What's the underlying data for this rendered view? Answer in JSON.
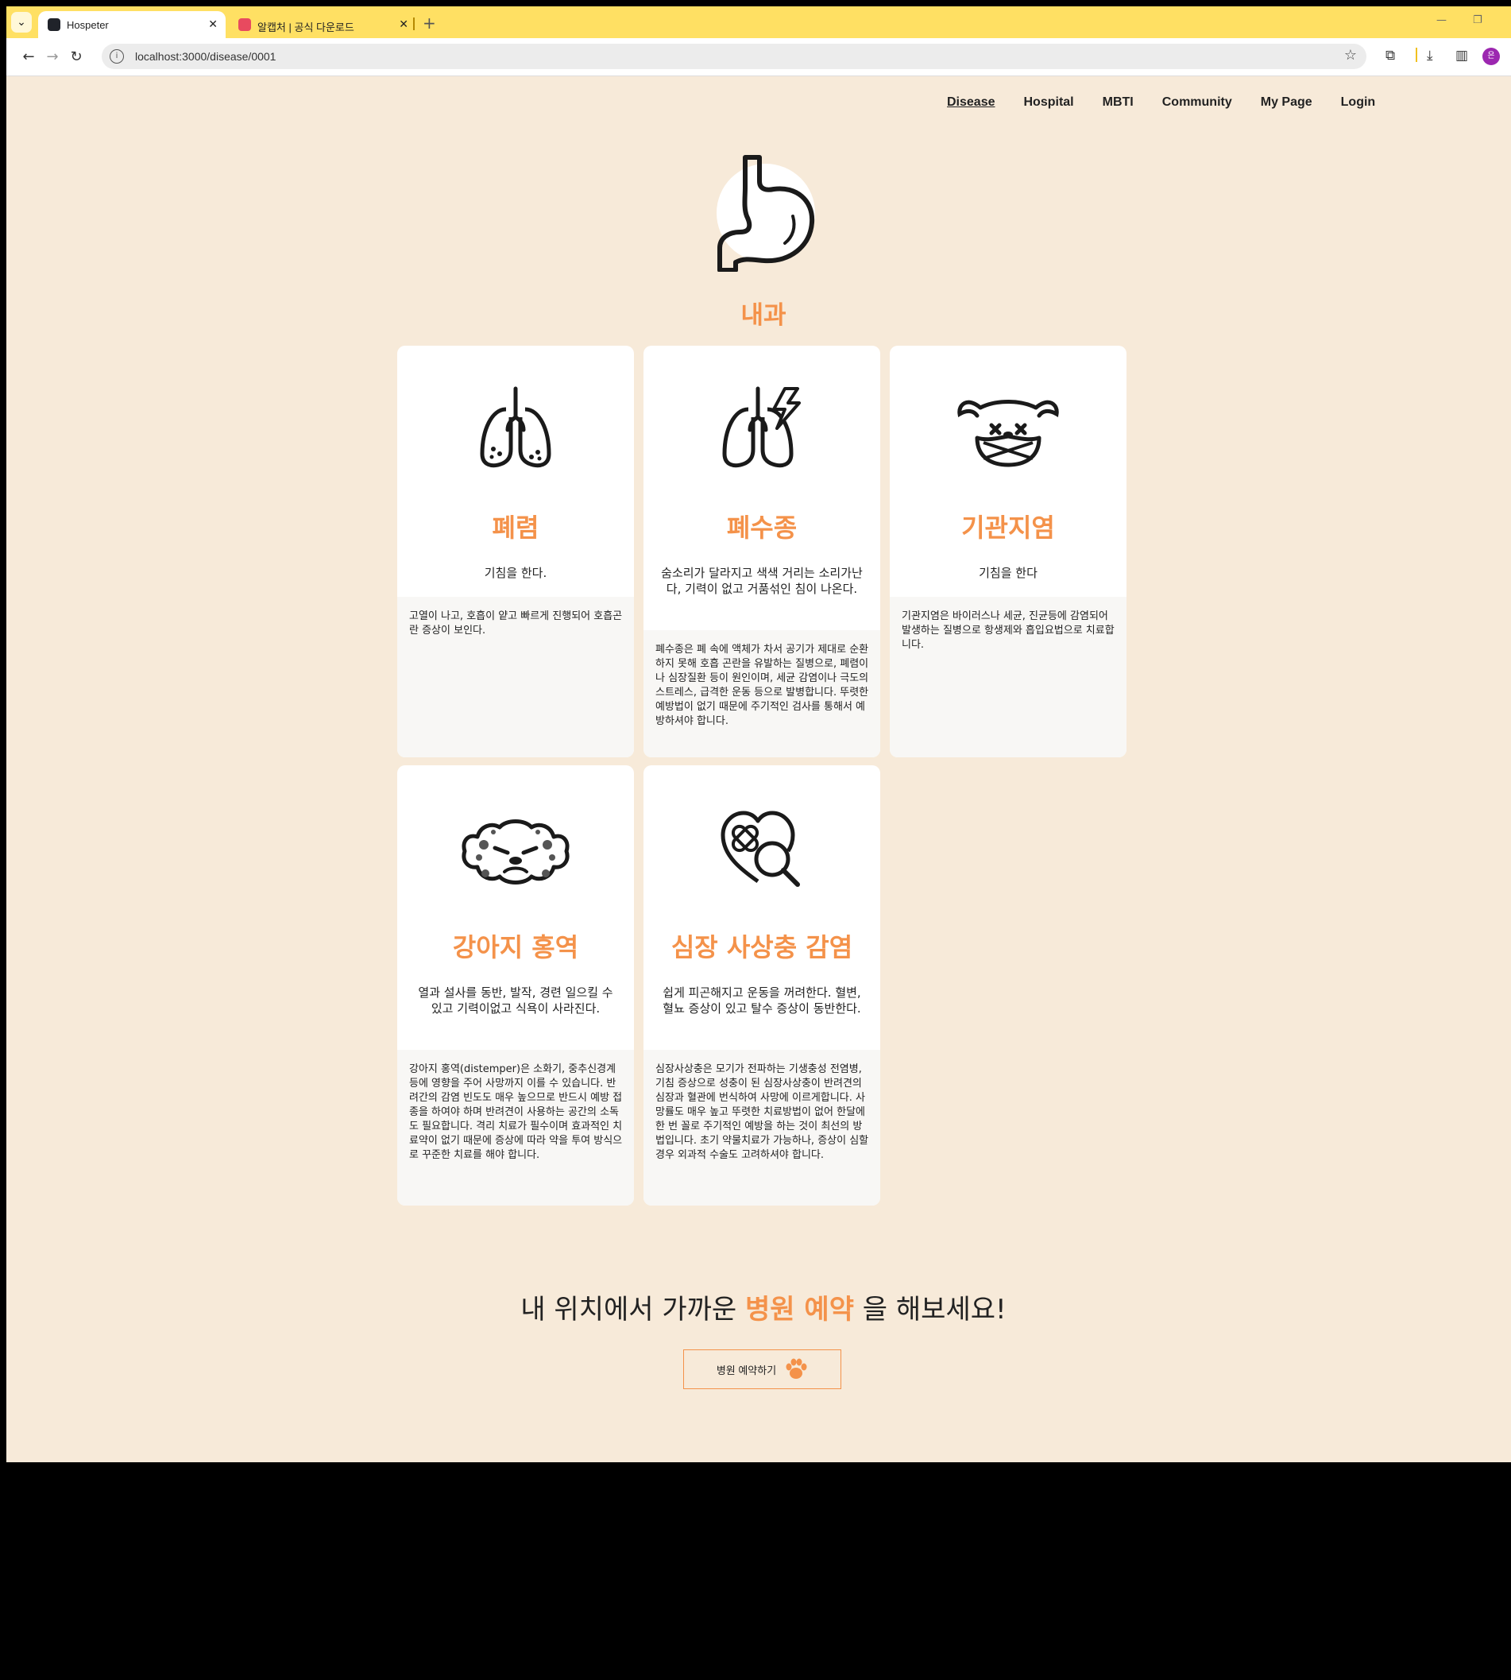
{
  "browser": {
    "tabs": [
      {
        "title": "Hospeter",
        "active": true
      },
      {
        "title": "알캡처 | 공식 다운로드",
        "active": false
      }
    ],
    "url": "localhost:3000/disease/0001",
    "profile_initial": "은"
  },
  "nav": {
    "items": [
      "Disease",
      "Hospital",
      "MBTI",
      "Community",
      "My Page",
      "Login"
    ],
    "current": "Disease"
  },
  "department": {
    "title": "내과",
    "icon": "stomach-icon"
  },
  "diseases": [
    {
      "name": "폐렴",
      "icon": "infected-lungs-icon",
      "summary": "기침을 한다.",
      "detail": "고열이 나고, 호흡이 얕고 빠르게 진행되어 호흡곤란 증상이 보인다."
    },
    {
      "name": "폐수종",
      "icon": "lungs-lightning-icon",
      "summary": "숨소리가 달라지고 색색 거리는 소리가난다, 기력이 없고 거품섞인 침이 나온다.",
      "detail": "폐수종은 폐 속에 액체가 차서 공기가 제대로 순환하지 못해 호흡 곤란을 유발하는 질병으로, 폐렴이나 심장질환 등이 원인이며, 세균 감염이나 극도의 스트레스, 급격한 운동 등으로 발병합니다. 뚜렷한 예방법이 없기 때문에 주기적인 검사를 통해서 예방하셔야 합니다."
    },
    {
      "name": "기관지염",
      "icon": "dog-mask-icon",
      "summary": "기침을 한다",
      "detail": "기관지염은 바이러스나 세균, 진균등에 감염되어 발생하는 질병으로 항생제와 흡입요법으로 치료합니다."
    },
    {
      "name": "강아지 홍역",
      "icon": "sick-dog-face-icon",
      "summary": "열과 설사를 동반, 발작, 경련 일으킬 수 있고 기력이없고 식욕이 사라진다.",
      "detail": "강아지 홍역(distemper)은 소화기, 중추신경계 등에 영향을 주어 사망까지 이를 수 있습니다. 반려간의 감염 빈도도 매우 높으므로 반드시 예방 접종을 하여야 하며 반려견이 사용하는 공간의 소독도 필요합니다. 격리 치료가 필수이며 효과적인 치료약이 없기 때문에 증상에 따라 약을 투여 방식으로 꾸준한 치료를 해야 합니다."
    },
    {
      "name": "심장 사상충 감염",
      "icon": "heart-magnifier-icon",
      "summary": "쉽게 피곤해지고 운동을 꺼려한다. 혈변, 혈뇨 증상이 있고 탈수 증상이 동반한다.",
      "detail": "심장사상충은 모기가 전파하는 기생충성 전염병, 기침 증상으로 성충이 된 심장사상충이 반려견의 심장과 혈관에 번식하여 사망에 이르게합니다. 사망률도 매우 높고 뚜렷한 치료방법이 없어 한달에 한 번 꼴로 주기적인 예방을 하는 것이 최선의 방법입니다. 초기 약물치료가 가능하나, 증상이 심할 경우 외과적 수술도 고려하셔야 합니다."
    }
  ],
  "cta": {
    "prefix": "내 위치에서 가까운 ",
    "highlight": "병원 예약",
    "suffix": " 을 해보세요!",
    "button_label": "병원 예약하기",
    "button_icon": "paw-icon"
  },
  "colors": {
    "accent": "#f4924a",
    "background": "#f7ead9",
    "tabstrip": "#ffe063"
  }
}
